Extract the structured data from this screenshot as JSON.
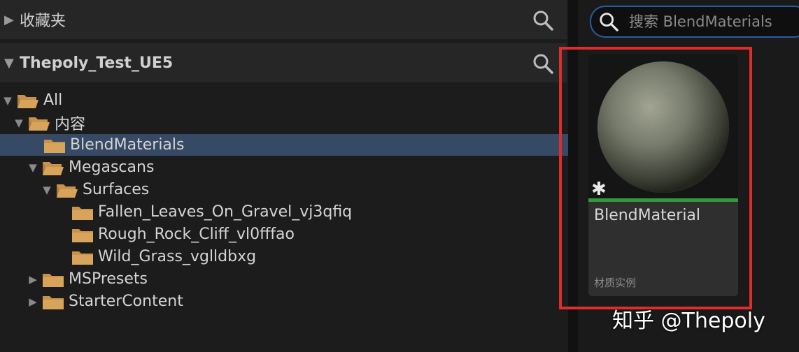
{
  "favorites": {
    "label": "收藏夹"
  },
  "project": {
    "label": "Thepoly_Test_UE5"
  },
  "tree": [
    {
      "label": "All"
    },
    {
      "label": "内容"
    },
    {
      "label": "BlendMaterials"
    },
    {
      "label": "Megascans"
    },
    {
      "label": "Surfaces"
    },
    {
      "label": "Fallen_Leaves_On_Gravel_vj3qfiq"
    },
    {
      "label": "Rough_Rock_Cliff_vl0fffao"
    },
    {
      "label": "Wild_Grass_vglldbxg"
    },
    {
      "label": "MSPresets"
    },
    {
      "label": "StarterContent"
    }
  ],
  "search": {
    "placeholder": "搜索 BlendMaterials"
  },
  "asset": {
    "name": "BlendMaterial",
    "type": "材质实例",
    "badge": "✱"
  },
  "watermark": "知乎 @Thepoly",
  "colors": {
    "selected_row": "#364a66",
    "highlight_border": "#e02c2c",
    "asset_bar": "#2e9b3c",
    "search_border": "#2b5b9e"
  }
}
